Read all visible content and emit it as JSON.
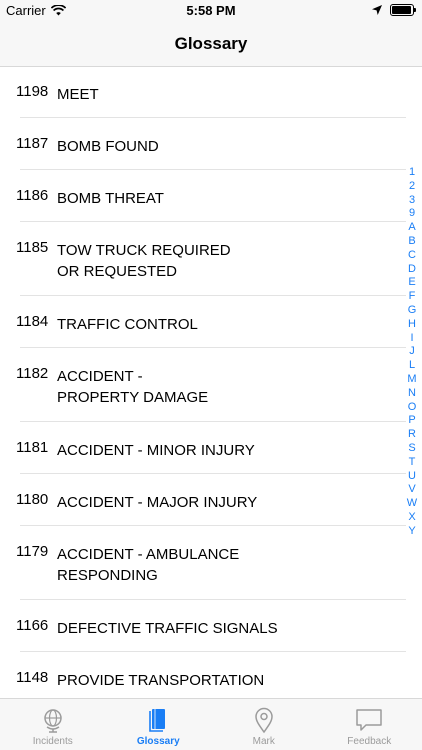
{
  "status": {
    "carrier": "Carrier",
    "time": "5:58 PM"
  },
  "nav": {
    "title": "Glossary"
  },
  "items": [
    {
      "code": "1198",
      "label": "MEET"
    },
    {
      "code": "1187",
      "label": "BOMB FOUND"
    },
    {
      "code": "1186",
      "label": "BOMB THREAT"
    },
    {
      "code": "1185",
      "label": "TOW TRUCK REQUIRED\nOR REQUESTED"
    },
    {
      "code": "1184",
      "label": "TRAFFIC CONTROL"
    },
    {
      "code": "1182",
      "label": "ACCIDENT -\nPROPERTY DAMAGE"
    },
    {
      "code": "1181",
      "label": "ACCIDENT - MINOR INJURY"
    },
    {
      "code": "1180",
      "label": "ACCIDENT - MAJOR INJURY"
    },
    {
      "code": "1179",
      "label": "ACCIDENT - AMBULANCE\nRESPONDING"
    },
    {
      "code": "1166",
      "label": "DEFECTIVE TRAFFIC SIGNALS"
    },
    {
      "code": "1148",
      "label": "PROVIDE TRANSPORTATION"
    }
  ],
  "index": [
    "1",
    "2",
    "3",
    "9",
    "A",
    "B",
    "C",
    "D",
    "E",
    "F",
    "G",
    "H",
    "I",
    "J",
    "L",
    "M",
    "N",
    "O",
    "P",
    "R",
    "S",
    "T",
    "U",
    "V",
    "W",
    "X",
    "Y"
  ],
  "tabs": [
    {
      "label": "Incidents",
      "icon": "globe-icon"
    },
    {
      "label": "Glossary",
      "icon": "book-icon"
    },
    {
      "label": "Mark",
      "icon": "map-pin-icon"
    },
    {
      "label": "Feedback",
      "icon": "speech-bubble-icon"
    }
  ],
  "colors": {
    "accent": "#1a7ef5",
    "inactive": "#9b9b9b",
    "bar": "#f7f7f7"
  }
}
